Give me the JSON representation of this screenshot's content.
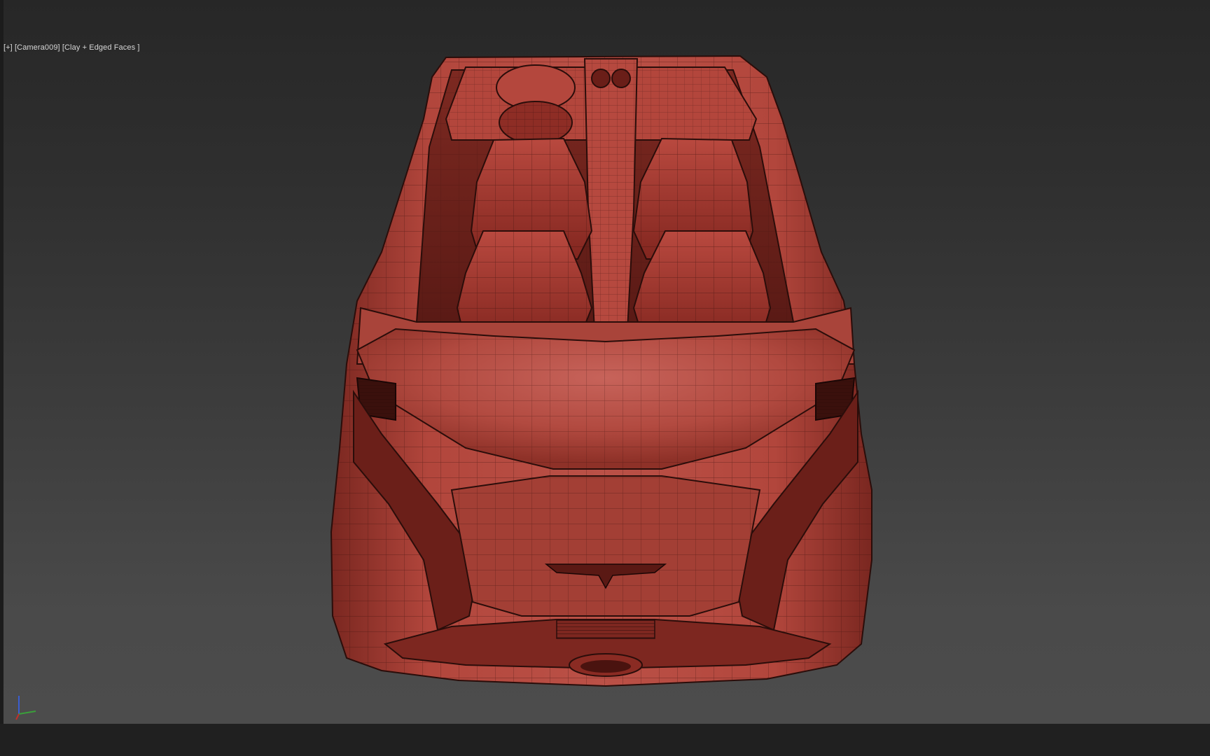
{
  "viewport": {
    "label_plus": "[+]",
    "label_camera": "[Camera009]",
    "label_shading": "[Clay + Edged Faces ]",
    "background_top": "#272727",
    "background_bottom": "#4c4c4c"
  },
  "model": {
    "subject": "car-model",
    "material_color": "#b84a3e",
    "wire_color": "#2a0d0a"
  },
  "gizmo": {
    "icon": "axis-gizmo-icon",
    "x_color": "#c0302a",
    "y_color": "#3aa03a",
    "z_color": "#3a5ed0"
  }
}
